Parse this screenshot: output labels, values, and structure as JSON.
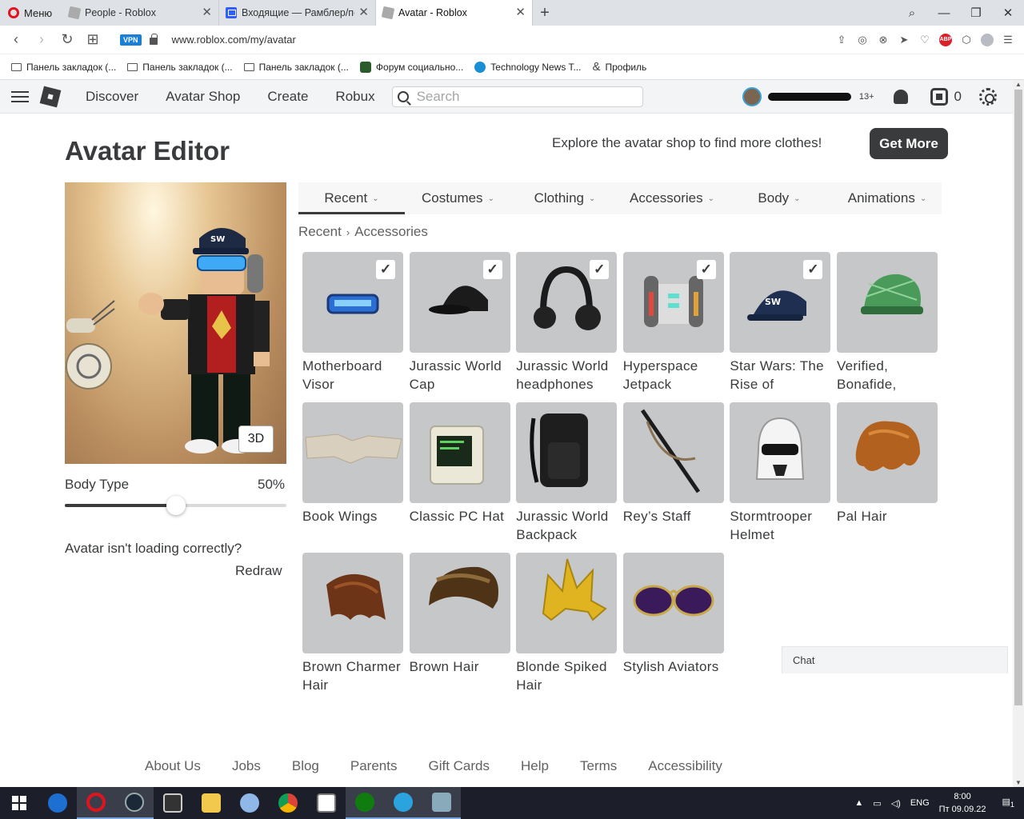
{
  "browser": {
    "menu_label": "Меню",
    "tabs": [
      {
        "title": "People - Roblox",
        "icon": "roblox-icon"
      },
      {
        "title": "Входящие — Рамблер/по",
        "icon": "mail-icon"
      },
      {
        "title": "Avatar - Roblox",
        "icon": "roblox-icon",
        "active": true
      }
    ],
    "url": "www.roblox.com/my/avatar",
    "vpn_label": "VPN",
    "abp_label": "ABP",
    "bookmarks": [
      {
        "label": "Панель закладок (...",
        "icon": "folder-icon"
      },
      {
        "label": "Панель закладок (...",
        "icon": "folder-icon"
      },
      {
        "label": "Панель закладок (...",
        "icon": "folder-icon"
      },
      {
        "label": "Форум социально...",
        "icon": "forum-icon"
      },
      {
        "label": "Technology News T...",
        "icon": "news-icon"
      },
      {
        "label": "Профиль",
        "icon": "ampersand-icon"
      }
    ]
  },
  "header": {
    "nav": [
      "Discover",
      "Avatar Shop",
      "Create",
      "Robux"
    ],
    "search_placeholder": "Search",
    "age_badge": "13+",
    "robux_count": "0"
  },
  "page": {
    "title": "Avatar Editor",
    "promo_text": "Explore the avatar shop to find more clothes!",
    "get_more_label": "Get More",
    "view_toggle_label": "3D",
    "body_type_label": "Body Type",
    "body_type_value": "50%",
    "body_type_fraction": 0.5,
    "load_message": "Avatar isn't loading correctly?",
    "redraw_label": "Redraw",
    "category_tabs": [
      "Recent",
      "Costumes",
      "Clothing",
      "Accessories",
      "Body",
      "Animations"
    ],
    "active_tab": "Recent",
    "breadcrumb": [
      "Recent",
      "Accessories"
    ]
  },
  "items": [
    {
      "name": "Motherboard Visor",
      "equipped": true
    },
    {
      "name": "Jurassic World Cap",
      "equipped": true
    },
    {
      "name": "Jurassic World headphones",
      "equipped": true
    },
    {
      "name": "Hyperspace Jetpack",
      "equipped": true
    },
    {
      "name": "Star Wars: The Rise of",
      "equipped": true
    },
    {
      "name": "Verified, Bonafide,",
      "equipped": false
    },
    {
      "name": "Book Wings",
      "equipped": false
    },
    {
      "name": "Classic PC Hat",
      "equipped": false
    },
    {
      "name": "Jurassic World Backpack",
      "equipped": false
    },
    {
      "name": "Rey’s Staff",
      "equipped": false
    },
    {
      "name": "Stormtrooper Helmet",
      "equipped": false
    },
    {
      "name": "Pal Hair",
      "equipped": false
    },
    {
      "name": "Brown Charmer Hair",
      "equipped": false
    },
    {
      "name": "Brown Hair",
      "equipped": false
    },
    {
      "name": "Blonde Spiked Hair",
      "equipped": false
    },
    {
      "name": "Stylish Aviators",
      "equipped": false
    }
  ],
  "footer": {
    "links": [
      "About Us",
      "Jobs",
      "Blog",
      "Parents",
      "Gift Cards",
      "Help",
      "Terms",
      "Accessibility"
    ],
    "chat_label": "Chat"
  },
  "taskbar": {
    "lang": "ENG",
    "time": "8:00",
    "date": "Пт 09.09.22",
    "notification_count": "1"
  }
}
